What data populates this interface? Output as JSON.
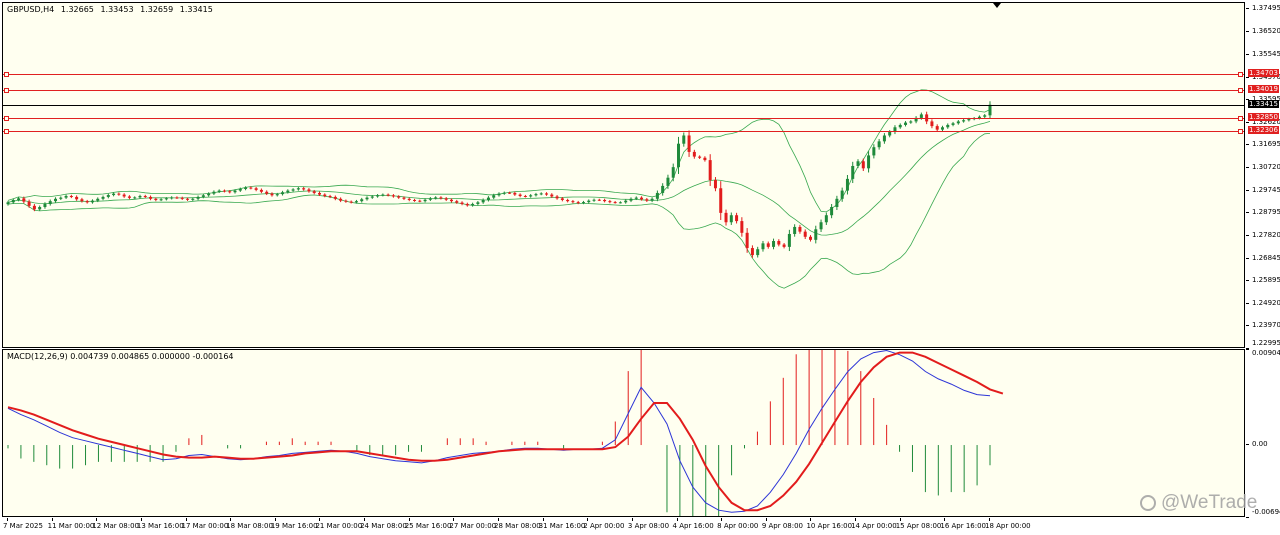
{
  "chart": {
    "symbol_label": "GBPUSD,H4",
    "ohlc": [
      "1.32665",
      "1.33453",
      "1.32659",
      "1.33415"
    ],
    "macd_label": "MACD(12,26,9) 0.004739 0.004865 0.000000 -0.000164",
    "watermark_text": "@WeTrade",
    "colors": {
      "background": "#fffff0",
      "bull_candle": "#1f8a3a",
      "bear_candle": "#e21c1c",
      "bands": "#38a84f",
      "hlines": "#e02020",
      "macd_line": "#2d35d6",
      "signal_line": "#e21c1c",
      "histogram_positive": "#e21c1c",
      "histogram_negative": "#1f8a3a"
    }
  },
  "chart_data": [
    {
      "type": "candlestick",
      "title": "GBPUSD,H4",
      "ylim": [
        1.22995,
        1.3775
      ],
      "price_ticks": [
        "1.37495",
        "1.36520",
        "1.35545",
        "1.34570",
        "1.33595",
        "1.32620",
        "1.31695",
        "1.30720",
        "1.29745",
        "1.28795",
        "1.27820",
        "1.26845",
        "1.25895",
        "1.24920",
        "1.23970",
        "1.22995"
      ],
      "horizontal_levels": [
        "1.34703",
        "1.34019",
        "1.32850",
        "1.32306"
      ],
      "current_price": "1.33415",
      "bar_type": "candle",
      "indicators": [
        "Bollinger Bands"
      ],
      "close": [
        1.2925,
        1.2935,
        1.2942,
        1.2928,
        1.291,
        1.2895,
        1.2905,
        1.2918,
        1.293,
        1.294,
        1.2945,
        1.2952,
        1.2948,
        1.2938,
        1.293,
        1.2925,
        1.2932,
        1.294,
        1.2948,
        1.2956,
        1.2962,
        1.2958,
        1.295,
        1.2944,
        1.2946,
        1.2952,
        1.2948,
        1.294,
        1.2935,
        1.2938,
        1.2942,
        1.2946,
        1.2944,
        1.294,
        1.2936,
        1.294,
        1.2948,
        1.2955,
        1.2962,
        1.297,
        1.2975,
        1.2972,
        1.2968,
        1.2975,
        1.2982,
        1.2988,
        1.2985,
        1.2978,
        1.297,
        1.2962,
        1.2955,
        1.296,
        1.2968,
        1.2975,
        1.298,
        1.2985,
        1.298,
        1.2972,
        1.2965,
        1.2958,
        1.2952,
        1.2948,
        1.294,
        1.2932,
        1.2928,
        1.2925,
        1.293,
        1.2938,
        1.2945,
        1.295,
        1.2955,
        1.2958,
        1.2955,
        1.295,
        1.2945,
        1.294,
        1.2935,
        1.2932,
        1.293,
        1.2936,
        1.2942,
        1.2946,
        1.2942,
        1.2936,
        1.293,
        1.2924,
        1.2918,
        1.2912,
        1.2918,
        1.2925,
        1.2935,
        1.2945,
        1.2955,
        1.2962,
        1.2966,
        1.2965,
        1.2958,
        1.2952,
        1.295,
        1.2955,
        1.296,
        1.2963,
        1.2958,
        1.295,
        1.2942,
        1.2935,
        1.293,
        1.2926,
        1.2922,
        1.2926,
        1.2932,
        1.2936,
        1.2935,
        1.293,
        1.2926,
        1.2924,
        1.2925,
        1.2932,
        1.294,
        1.2945,
        1.2938,
        1.2932,
        1.294,
        1.2965,
        1.2995,
        1.303,
        1.3075,
        1.3175,
        1.321,
        1.314,
        1.312,
        1.3115,
        1.3105,
        1.302,
        1.2985,
        1.288,
        1.284,
        1.287,
        1.2845,
        1.2795,
        1.273,
        1.27,
        1.2725,
        1.275,
        1.2735,
        1.276,
        1.2745,
        1.2735,
        1.279,
        1.282,
        1.28,
        1.2778,
        1.2765,
        1.281,
        1.284,
        1.287,
        1.2905,
        1.294,
        1.2975,
        1.3025,
        1.308,
        1.31,
        1.307,
        1.3125,
        1.316,
        1.3185,
        1.321,
        1.3225,
        1.3245,
        1.3255,
        1.3265,
        1.327,
        1.3285,
        1.33,
        1.327,
        1.325,
        1.3235,
        1.3245,
        1.3255,
        1.3262,
        1.327,
        1.3275,
        1.328,
        1.3284,
        1.329,
        1.3296,
        1.3341
      ]
    },
    {
      "type": "line",
      "title": "MACD(12,26,9)",
      "ylim": [
        -0.006946,
        0.009048
      ],
      "ticks": [
        "0.009048",
        "0.00",
        "-0.006946"
      ],
      "series": [
        {
          "name": "MACD",
          "values": [
            0.0035,
            0.0029,
            0.0024,
            0.0018,
            0.0012,
            0.0007,
            0.0004,
            0.0001,
            -0.0002,
            -0.0005,
            -0.0008,
            -0.0011,
            -0.0014,
            -0.0013,
            -0.001,
            -0.0009,
            -0.0011,
            -0.0013,
            -0.0014,
            -0.0013,
            -0.0011,
            -0.001,
            -0.0008,
            -0.0007,
            -0.0006,
            -0.0005,
            -0.0006,
            -0.0008,
            -0.0011,
            -0.0013,
            -0.0015,
            -0.0016,
            -0.0017,
            -0.0015,
            -0.0012,
            -0.001,
            -0.0008,
            -0.0007,
            -0.0006,
            -0.0004,
            -0.0003,
            -0.0003,
            -0.0004,
            -0.0005,
            -0.0004,
            -0.0004,
            -0.0003,
            0.0005,
            0.003,
            0.0055,
            0.004,
            0.002,
            -0.0015,
            -0.004,
            -0.0055,
            -0.0062,
            -0.0064,
            -0.0063,
            -0.0058,
            -0.0045,
            -0.0028,
            -0.0008,
            0.0015,
            0.0035,
            0.0053,
            0.007,
            0.0082,
            0.0088,
            0.009,
            0.0086,
            0.008,
            0.007,
            0.0063,
            0.0058,
            0.0052,
            0.0048,
            0.0047
          ]
        },
        {
          "name": "Signal",
          "values": [
            0.0036,
            0.0033,
            0.0029,
            0.0024,
            0.0019,
            0.0014,
            0.001,
            0.0006,
            0.0003,
            0.0,
            -0.0003,
            -0.0006,
            -0.0009,
            -0.0011,
            -0.0012,
            -0.0012,
            -0.0011,
            -0.0012,
            -0.0013,
            -0.0013,
            -0.0012,
            -0.0011,
            -0.001,
            -0.0008,
            -0.0007,
            -0.0006,
            -0.0006,
            -0.0006,
            -0.0008,
            -0.001,
            -0.0012,
            -0.0014,
            -0.0015,
            -0.0015,
            -0.0014,
            -0.0012,
            -0.001,
            -0.0008,
            -0.0006,
            -0.0005,
            -0.0004,
            -0.0004,
            -0.0004,
            -0.0004,
            -0.0004,
            -0.0004,
            -0.0004,
            -0.0002,
            0.0008,
            0.0025,
            0.004,
            0.004,
            0.0025,
            0.0005,
            -0.002,
            -0.004,
            -0.0055,
            -0.0062,
            -0.0062,
            -0.0058,
            -0.0048,
            -0.0035,
            -0.0018,
            0.0002,
            0.0022,
            0.0042,
            0.006,
            0.0074,
            0.0084,
            0.0088,
            0.0088,
            0.0084,
            0.0078,
            0.0072,
            0.0066,
            0.006,
            0.0053,
            0.0049
          ]
        }
      ]
    }
  ],
  "time_axis": [
    "7 Mar 2025",
    "11 Mar 00:00",
    "12 Mar 08:00",
    "13 Mar 16:00",
    "17 Mar 00:00",
    "18 Mar 08:00",
    "19 Mar 16:00",
    "21 Mar 00:00",
    "24 Mar 08:00",
    "25 Mar 16:00",
    "27 Mar 00:00",
    "28 Mar 08:00",
    "31 Mar 16:00",
    "2 Apr 00:00",
    "3 Apr 08:00",
    "4 Apr 16:00",
    "8 Apr 00:00",
    "9 Apr 08:00",
    "10 Apr 16:00",
    "14 Apr 00:00",
    "15 Apr 08:00",
    "16 Apr 16:00",
    "18 Apr 00:00"
  ]
}
